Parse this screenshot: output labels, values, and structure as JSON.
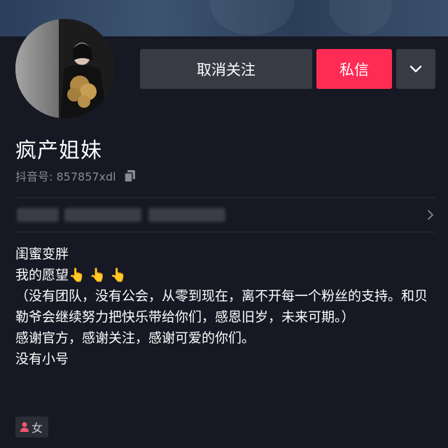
{
  "profile": {
    "display_name": "疯产姐妹",
    "id_label": "抖音号: 857857xdl",
    "gender": "女"
  },
  "actions": {
    "unfollow_label": "取消关注",
    "message_label": "私信"
  },
  "bio": {
    "lines": [
      "闺蜜变胖",
      "我的愿望",
      "（没有团队，没有公会，从零到现在，离不开每一个粉丝的支持。和贝勒爷会继续努力把快乐带给你们，感恩旧岁，未来可期。）",
      "感谢官方，感谢关注，感谢可爱的你们。",
      "没有小号"
    ],
    "wish_emoji": "👆 👆 👆"
  },
  "colors": {
    "background": "#161823",
    "accent": "#fe2c55",
    "button_gray": "#393b44",
    "muted_text": "#8a8b91"
  },
  "icons": [
    "copy-icon",
    "chevron-down-icon",
    "chevron-right-icon",
    "female-person-icon"
  ]
}
